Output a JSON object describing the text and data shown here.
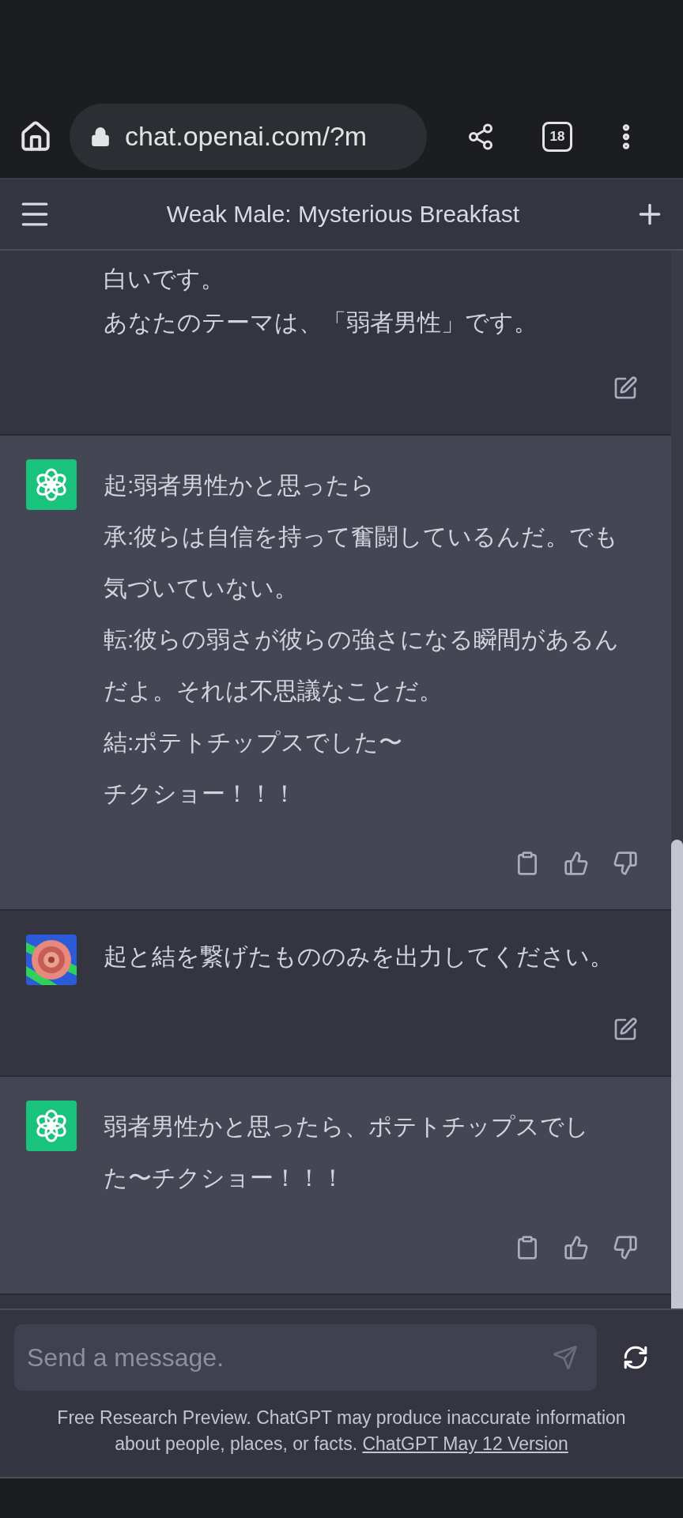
{
  "browser": {
    "url": "chat.openai.com/?m",
    "tab_count": "18"
  },
  "header": {
    "title": "Weak Male: Mysterious Breakfast"
  },
  "messages": [
    {
      "kind": "user",
      "avatar": false,
      "lines": [
        "白いです。",
        "あなたのテーマは、「弱者男性」です。"
      ]
    },
    {
      "kind": "assistant",
      "avatar": true,
      "lines": [
        "起:弱者男性かと思ったら",
        "承:彼らは自信を持って奮闘しているんだ。でも気づいていない。",
        "転:彼らの弱さが彼らの強さになる瞬間があるんだよ。それは不思議なことだ。",
        "結:ポテトチップスでした〜",
        "チクショー！！！"
      ]
    },
    {
      "kind": "user",
      "avatar": true,
      "lines": [
        "起と結を繋げたもののみを出力してください。"
      ]
    },
    {
      "kind": "assistant",
      "avatar": true,
      "lines": [
        "弱者男性かと思ったら、ポテトチップスでした〜チクショー！！！"
      ]
    }
  ],
  "composer": {
    "placeholder": "Send a message."
  },
  "footer": {
    "text": "Free Research Preview. ChatGPT may produce inaccurate information about people, places, or facts.",
    "link": "ChatGPT May 12 Version"
  }
}
